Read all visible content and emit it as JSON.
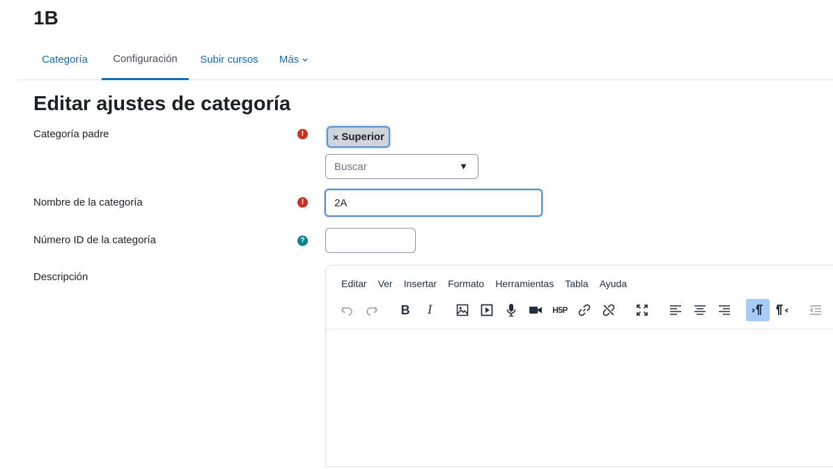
{
  "page": {
    "title": "1B"
  },
  "nav": {
    "tabs": [
      {
        "label": "Categoría",
        "active": false
      },
      {
        "label": "Configuración",
        "active": true
      },
      {
        "label": "Subir cursos",
        "active": false
      },
      {
        "label": "Más",
        "active": false
      }
    ]
  },
  "form": {
    "heading": "Editar ajustes de categoría",
    "parent_category": {
      "label": "Categoría padre",
      "selected_chip": "Superior",
      "chip_remove_glyph": "×",
      "search_placeholder": "Buscar",
      "caret": "▼"
    },
    "category_name": {
      "label": "Nombre de la categoría",
      "value": "2A"
    },
    "category_id": {
      "label": "Número ID de la categoría",
      "value": ""
    },
    "description": {
      "label": "Descripción"
    },
    "required_glyph": "!",
    "help_glyph": "?"
  },
  "editor": {
    "menu": [
      "Editar",
      "Ver",
      "Insertar",
      "Formato",
      "Herramientas",
      "Tabla",
      "Ayuda"
    ],
    "toolbar_icons": [
      "undo-icon",
      "redo-icon",
      "bold-icon",
      "italic-icon",
      "image-icon",
      "media-icon",
      "microphone-icon",
      "video-camera-icon",
      "h5p-icon",
      "link-icon",
      "unlink-icon",
      "fullscreen-icon",
      "align-left-icon",
      "align-center-icon",
      "align-right-icon",
      "ltr-icon",
      "rtl-icon",
      "outdent-icon"
    ],
    "h5p_text": "H5P",
    "bold_text": "B",
    "italic_text": "I"
  },
  "colors": {
    "link": "#0f6cbf",
    "required": "#ca3120",
    "help": "#008196",
    "focus_border": "#5b90c9",
    "toolbar_active": "#a6ccf7"
  }
}
